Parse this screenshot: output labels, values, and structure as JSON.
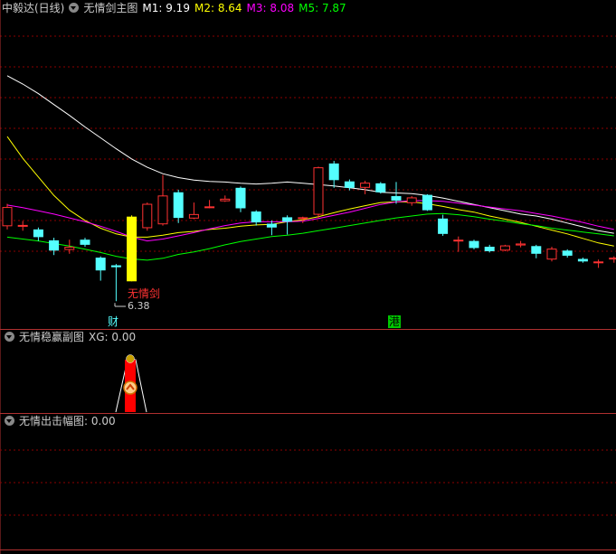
{
  "main_header": {
    "stock": "中毅达(日线)",
    "indicator": "无情剑主图",
    "m1": "M1: 9.19",
    "m2": "M2: 8.64",
    "m3": "M3: 8.08",
    "m5": "M5: 7.87"
  },
  "sub1_header": {
    "indicator": "无情稳赢副图",
    "xg": "XG: 0.00"
  },
  "sub2_header": {
    "indicator": "无情出击幅图",
    "value": ": 0.00"
  },
  "annotations": {
    "signal": "无情剑",
    "low_price": "6.38",
    "marker_cai": "财",
    "marker_gang": "港"
  },
  "colors": {
    "up": "#ff3232",
    "down": "#54ffff",
    "signal_bar": "#ffff00",
    "m1": "#ffffff",
    "m2": "#ffff00",
    "m3": "#ff00ff",
    "m5": "#00ff00",
    "grid": "#8b0000"
  },
  "chart_data": {
    "type": "candlestick",
    "title": "中毅达(日线)",
    "ylim": [
      6.2,
      10.8
    ],
    "series": [
      {
        "name": "M1",
        "last": 9.19
      },
      {
        "name": "M2",
        "last": 8.64
      },
      {
        "name": "M3",
        "last": 8.08
      },
      {
        "name": "M5",
        "last": 7.87
      }
    ],
    "candles": [
      {
        "o": 7.55,
        "h": 7.9,
        "l": 7.5,
        "c": 7.85
      },
      {
        "o": 7.55,
        "h": 7.63,
        "l": 7.48,
        "c": 7.57
      },
      {
        "o": 7.5,
        "h": 7.53,
        "l": 7.32,
        "c": 7.38
      },
      {
        "o": 7.33,
        "h": 7.37,
        "l": 7.1,
        "c": 7.17
      },
      {
        "o": 7.18,
        "h": 7.34,
        "l": 7.12,
        "c": 7.23
      },
      {
        "o": 7.34,
        "h": 7.37,
        "l": 7.23,
        "c": 7.26
      },
      {
        "o": 7.06,
        "h": 7.08,
        "l": 6.7,
        "c": 6.86
      },
      {
        "o": 6.94,
        "h": 6.96,
        "l": 6.38,
        "c": 6.91
      },
      {
        "o": 7.7,
        "h": 7.72,
        "l": 6.69,
        "c": 6.69
      },
      {
        "o": 7.52,
        "h": 7.92,
        "l": 7.48,
        "c": 7.9
      },
      {
        "o": 7.58,
        "h": 8.35,
        "l": 7.56,
        "c": 8.03
      },
      {
        "o": 8.08,
        "h": 8.12,
        "l": 7.6,
        "c": 7.68
      },
      {
        "o": 7.67,
        "h": 7.92,
        "l": 7.66,
        "c": 7.74
      },
      {
        "o": 7.85,
        "h": 7.96,
        "l": 7.83,
        "c": 7.86
      },
      {
        "o": 7.94,
        "h": 8.03,
        "l": 7.93,
        "c": 7.98
      },
      {
        "o": 8.15,
        "h": 8.17,
        "l": 7.77,
        "c": 7.83
      },
      {
        "o": 7.78,
        "h": 7.8,
        "l": 7.56,
        "c": 7.61
      },
      {
        "o": 7.59,
        "h": 7.64,
        "l": 7.41,
        "c": 7.53
      },
      {
        "o": 7.69,
        "h": 7.72,
        "l": 7.42,
        "c": 7.62
      },
      {
        "o": 7.68,
        "h": 7.7,
        "l": 7.6,
        "c": 7.69
      },
      {
        "o": 7.73,
        "h": 8.48,
        "l": 7.68,
        "c": 8.47
      },
      {
        "o": 8.53,
        "h": 8.57,
        "l": 8.15,
        "c": 8.27
      },
      {
        "o": 8.25,
        "h": 8.28,
        "l": 8.11,
        "c": 8.15
      },
      {
        "o": 8.15,
        "h": 8.26,
        "l": 8.05,
        "c": 8.23
      },
      {
        "o": 8.22,
        "h": 8.24,
        "l": 8.06,
        "c": 8.08
      },
      {
        "o": 8.02,
        "h": 8.24,
        "l": 7.9,
        "c": 7.95
      },
      {
        "o": 7.91,
        "h": 8.02,
        "l": 7.87,
        "c": 8.0
      },
      {
        "o": 8.04,
        "h": 8.05,
        "l": 7.79,
        "c": 7.8
      },
      {
        "o": 7.67,
        "h": 7.73,
        "l": 7.4,
        "c": 7.43
      },
      {
        "o": 7.33,
        "h": 7.39,
        "l": 7.15,
        "c": 7.34
      },
      {
        "o": 7.32,
        "h": 7.34,
        "l": 7.19,
        "c": 7.21
      },
      {
        "o": 7.23,
        "h": 7.26,
        "l": 7.14,
        "c": 7.16
      },
      {
        "o": 7.17,
        "h": 7.26,
        "l": 7.16,
        "c": 7.25
      },
      {
        "o": 7.25,
        "h": 7.32,
        "l": 7.22,
        "c": 7.28
      },
      {
        "o": 7.24,
        "h": 7.26,
        "l": 7.05,
        "c": 7.12
      },
      {
        "o": 7.03,
        "h": 7.23,
        "l": 7.0,
        "c": 7.2
      },
      {
        "o": 7.17,
        "h": 7.19,
        "l": 7.06,
        "c": 7.09
      },
      {
        "o": 7.04,
        "h": 7.06,
        "l": 6.98,
        "c": 7.0
      },
      {
        "o": 6.99,
        "h": 7.03,
        "l": 6.9,
        "c": 7.0
      },
      {
        "o": 7.03,
        "h": 7.08,
        "l": 6.98,
        "c": 7.06
      }
    ],
    "ma_lines": {
      "M1": [
        9.9,
        9.77,
        9.62,
        9.45,
        9.28,
        9.1,
        8.93,
        8.76,
        8.6,
        8.47,
        8.37,
        8.31,
        8.27,
        8.25,
        8.24,
        8.22,
        8.21,
        8.22,
        8.24,
        8.22,
        8.2,
        8.18,
        8.15,
        8.12,
        8.08,
        8.07,
        8.06,
        8.03,
        7.99,
        7.94,
        7.89,
        7.84,
        7.79,
        7.74,
        7.71,
        7.66,
        7.6,
        7.54,
        7.48,
        7.44
      ],
      "M2": [
        8.95,
        8.61,
        8.32,
        8.03,
        7.8,
        7.64,
        7.52,
        7.43,
        7.38,
        7.38,
        7.41,
        7.45,
        7.47,
        7.5,
        7.52,
        7.55,
        7.57,
        7.58,
        7.62,
        7.65,
        7.7,
        7.76,
        7.82,
        7.87,
        7.92,
        7.93,
        7.93,
        7.9,
        7.86,
        7.81,
        7.77,
        7.71,
        7.66,
        7.61,
        7.55,
        7.49,
        7.43,
        7.36,
        7.29,
        7.24
      ],
      "M3": [
        7.88,
        7.84,
        7.79,
        7.74,
        7.68,
        7.62,
        7.55,
        7.47,
        7.38,
        7.32,
        7.35,
        7.4,
        7.45,
        7.51,
        7.56,
        7.6,
        7.62,
        7.62,
        7.62,
        7.63,
        7.67,
        7.72,
        7.77,
        7.83,
        7.89,
        7.93,
        7.95,
        7.95,
        7.94,
        7.91,
        7.88,
        7.85,
        7.82,
        7.79,
        7.75,
        7.71,
        7.66,
        7.61,
        7.55,
        7.5
      ],
      "M5": [
        7.38,
        7.35,
        7.32,
        7.28,
        7.24,
        7.19,
        7.14,
        7.08,
        7.04,
        7.02,
        7.05,
        7.11,
        7.15,
        7.2,
        7.26,
        7.31,
        7.35,
        7.39,
        7.41,
        7.44,
        7.48,
        7.52,
        7.56,
        7.6,
        7.64,
        7.68,
        7.71,
        7.74,
        7.75,
        7.73,
        7.7,
        7.66,
        7.63,
        7.59,
        7.56,
        7.52,
        7.49,
        7.46,
        7.43,
        7.4
      ]
    }
  }
}
